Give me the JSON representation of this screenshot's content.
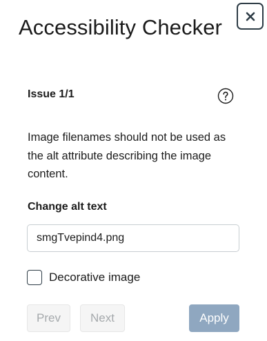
{
  "dialog": {
    "title": "Accessibility Checker",
    "close_icon": "close-icon"
  },
  "issue": {
    "label": "Issue 1/1",
    "help_icon": "question-circle-icon",
    "description": "Image filenames should not be used as the alt attribute describing the image content."
  },
  "form": {
    "field_label": "Change alt text",
    "alt_text_value": "smgTvepind4.png",
    "decorative_label": "Decorative image",
    "decorative_checked": false
  },
  "buttons": {
    "prev": "Prev",
    "next": "Next",
    "apply": "Apply"
  },
  "colors": {
    "apply_bg": "#8fa7c0",
    "disabled_bg": "#f5f5f5",
    "disabled_text": "#a5a9ac",
    "text": "#1b1b1b",
    "border": "#2d3b45"
  }
}
